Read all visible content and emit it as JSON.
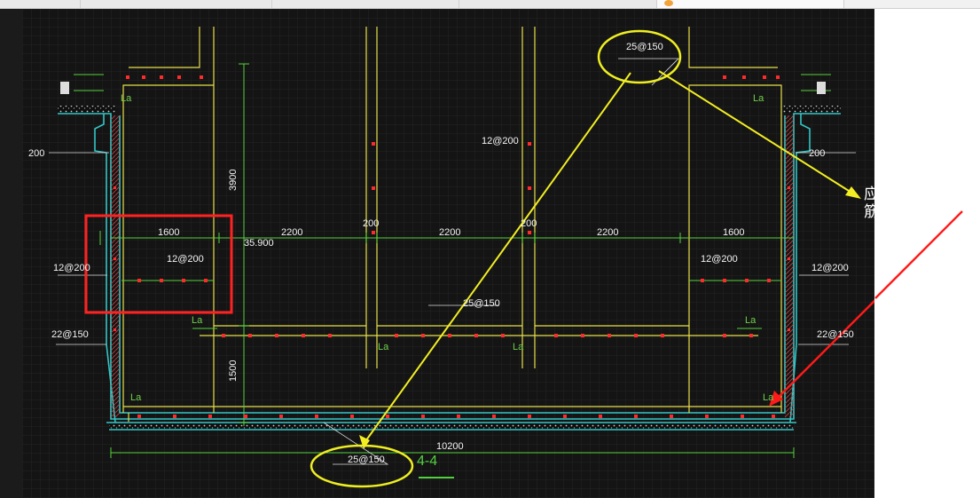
{
  "drawing": {
    "section_title": "4-4",
    "dims": {
      "d1600_left": "1600",
      "d2200_a": "2200",
      "d200_a": "200",
      "d2200_b": "2200",
      "d200_b": "200",
      "d2200_c": "2200",
      "d1600_right": "1600",
      "d3900": "3900",
      "d1500": "1500",
      "d10200": "10200",
      "elev": "35.900"
    },
    "rebar": {
      "top_right": "25@150",
      "mid_bottom": "25@150",
      "bottom": "25@150",
      "col_a": "12@200",
      "inner_left": "12@200",
      "inner_right": "12@200",
      "wall_left": "12@200",
      "wall_right": "12@200",
      "base_left": "22@150",
      "base_right": "22@150",
      "layer_left": "200",
      "layer_right": "200"
    },
    "anchor_labels": {
      "la_1": "La",
      "la_2": "La",
      "la_3": "La",
      "la_4": "La",
      "la_5": "La",
      "la_6": "La",
      "la_7": "La",
      "la_8": "La"
    }
  },
  "annotation": {
    "note_line1": "应该同这种钢",
    "note_line2": "筋形状"
  },
  "colors": {
    "canvas_bg": "#141414",
    "grid": "#262626",
    "wall": "#33c6c6",
    "dim": "#55d23c",
    "yellow": "#e8e04a",
    "red": "#ff2222"
  }
}
